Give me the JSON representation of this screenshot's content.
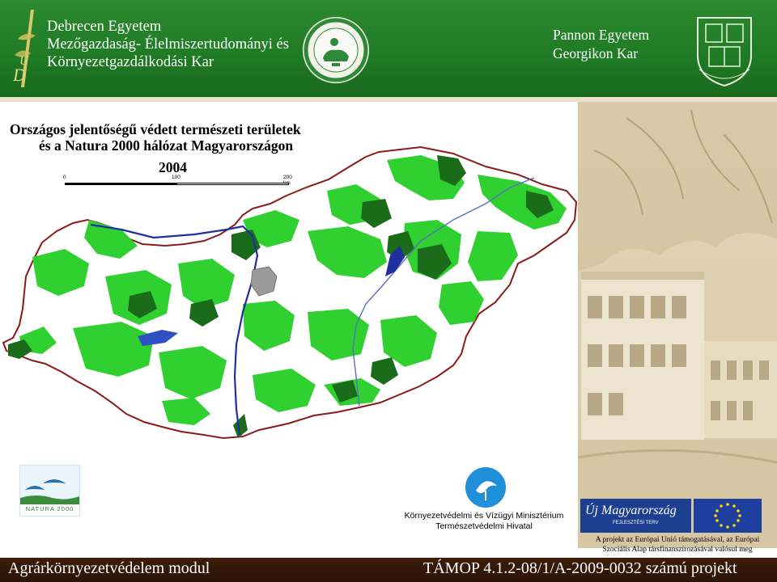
{
  "header": {
    "left_title_lines": [
      "Debrecen Egyetem",
      "Mezőgazdaság- Élelmiszertudományi és",
      "Környezetgazdálkodási Kar"
    ],
    "right_title_lines": [
      "Pannon Egyetem",
      "Georgikon Kar"
    ]
  },
  "map": {
    "title_lines": [
      "Országos jelentőségű védett természeti területek",
      "és a Natura 2000 hálózat Magyarországon"
    ],
    "year": "2004",
    "scale_labels": [
      "0",
      "100",
      "200 km"
    ]
  },
  "logos": {
    "natura_text": "NATURA 2000",
    "ministry_lines": [
      "Környezetvédelmi és Vízügyi Minisztérium",
      "Természetvédelmi Hivatal"
    ],
    "uj_magyarorszag": "Új Magyarország",
    "fejlesztesi_terv": "FEJLESZTÉSI TERV"
  },
  "eu_note_lines": [
    "A projekt az Európai Unió támogatásával, az Európai",
    "Szociális Alap társfinanszírozásával valósul meg"
  ],
  "footer": {
    "left": "Agrárkörnyezetvédelem modul",
    "right": "TÁMOP 4.1.2-08/1/A-2009-0032 számú projekt"
  },
  "colors": {
    "header_green": "#1f7a24",
    "footer_brown": "#2e1507",
    "protected_dark_green": "#1a6b1a",
    "natura_bright_green": "#2ecc2e",
    "border_red": "#8b1a1a",
    "danube_blue": "#1f2fa0",
    "budapest_grey": "#9a9a9a"
  }
}
